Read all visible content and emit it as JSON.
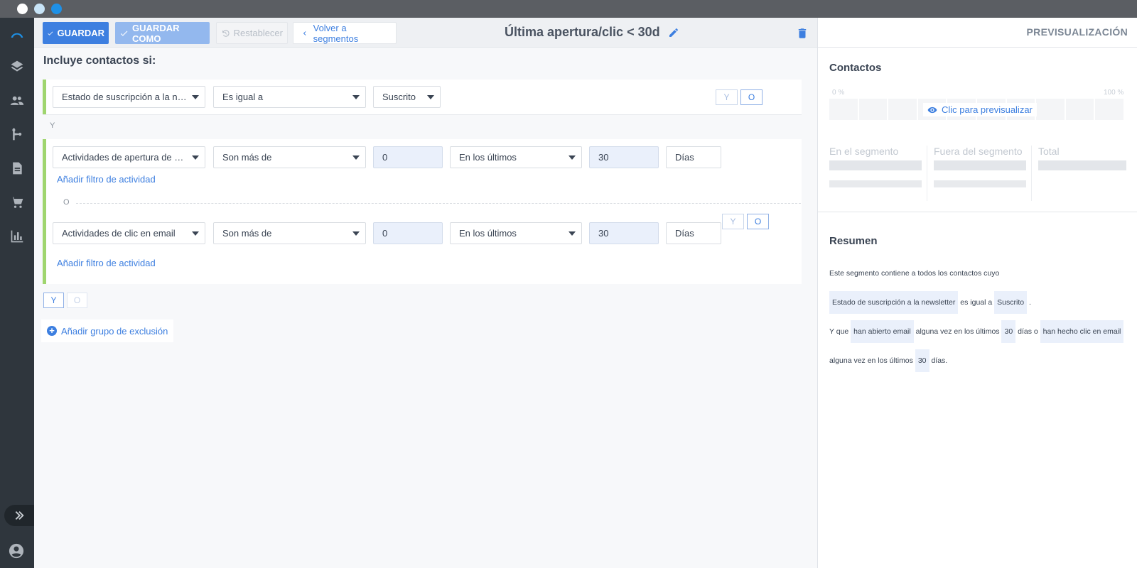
{
  "window": {
    "dots": [
      "#ffffff",
      "#c8e4f7",
      "#1e90e6"
    ]
  },
  "toolbar": {
    "save_label": "GUARDAR",
    "save_as_label": "GUARDAR COMO",
    "reset_label": "Restablecer",
    "back_label": "Volver a segmentos",
    "title": "Última apertura/clic < 30d"
  },
  "editor": {
    "include_label": "Incluye contactos si:",
    "group1": {
      "field": "Estado de suscripción a la newsletter",
      "operator": "Es igual a",
      "value": "Suscrito",
      "toggle_and": "Y",
      "toggle_or": "O"
    },
    "and_separator": "Y",
    "group2": {
      "row1": {
        "field": "Actividades de apertura de email",
        "operator": "Son más de",
        "count": "0",
        "period": "En los últimos",
        "amount": "30",
        "unit": "Días",
        "add_filter": "Añadir filtro de actividad"
      },
      "or_separator": "O",
      "row2": {
        "field": "Actividades de clic en email",
        "operator": "Son más de",
        "count": "0",
        "period": "En los últimos",
        "amount": "30",
        "unit": "Días",
        "add_filter": "Añadir filtro de actividad"
      },
      "toggle_and": "Y",
      "toggle_or": "O"
    },
    "bottom_toggle_and": "Y",
    "bottom_toggle_or": "O",
    "add_exclusion_label": "Añadir grupo de exclusión"
  },
  "preview": {
    "header": "PREVISUALIZACIÓN",
    "contacts_title": "Contactos",
    "pct_min": "0 %",
    "pct_max": "100 %",
    "click_to_preview": "Clic para previsualizar",
    "in_segment": "En el segmento",
    "out_segment": "Fuera del segmento",
    "total": "Total",
    "summary_title": "Resumen",
    "summary": {
      "t1": "Este segmento contiene a todos los contactos cuyo",
      "c1": "Estado de suscripción a la newsletter",
      "t2": "es igual a",
      "c2": "Suscrito",
      "t3": ".",
      "t4": "Y que",
      "c3": "han abierto email",
      "t5": "alguna vez en los últimos",
      "c4": "30",
      "t6": "días o",
      "c5": "han hecho clic en email",
      "t7": "alguna vez en los últimos",
      "c6": "30",
      "t8": "días."
    }
  },
  "colors": {
    "accent": "#3d7fe0",
    "group_border": "#9fd56e",
    "sidebar": "#2f363d"
  },
  "sidebar": {
    "icons": [
      "logo-icon",
      "layers-icon",
      "contacts-icon",
      "workflow-icon",
      "document-icon",
      "cart-icon",
      "chart-icon",
      "expand-icon",
      "user-icon"
    ]
  }
}
